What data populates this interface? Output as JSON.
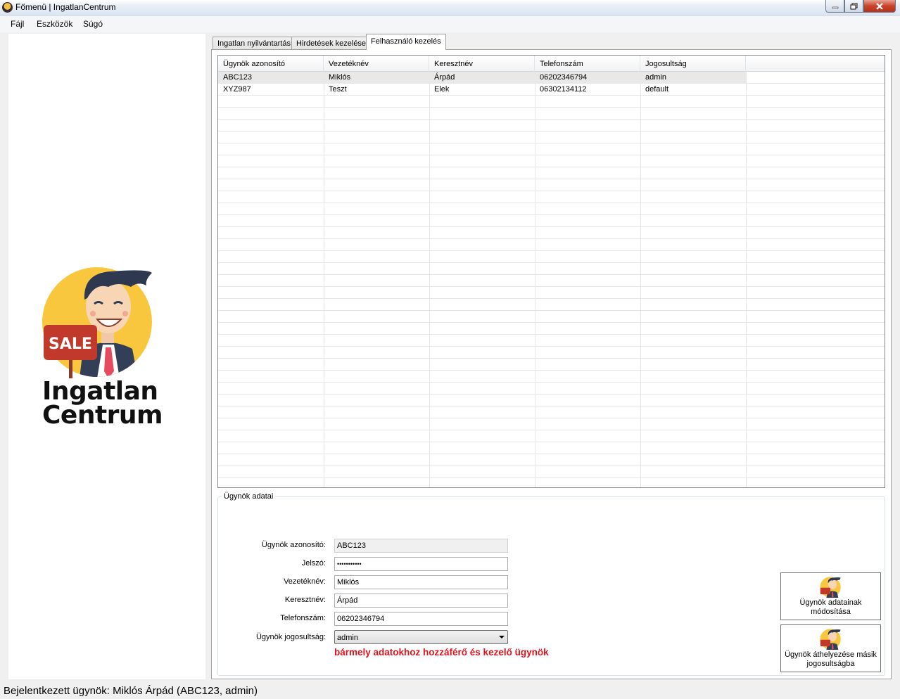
{
  "window": {
    "title": "Főmenü | IngatlanCentrum",
    "controls": [
      "minimize-icon",
      "maximize-icon",
      "close-icon"
    ]
  },
  "menu": {
    "items": [
      {
        "label": "Fájl"
      },
      {
        "label": "Eszközök"
      },
      {
        "label": "Súgó"
      }
    ]
  },
  "logo": {
    "sign_text": "SALE",
    "text_line1": "Ingatlan",
    "text_line2": "Centrum",
    "colors": {
      "circle": "#f9c73d",
      "suit": "#333e57",
      "tie": "#e64a5e",
      "sign": "#c0392b",
      "hair": "#2e3950"
    }
  },
  "tabs": [
    {
      "label": "Ingatlan nyilvántartás"
    },
    {
      "label": "Hirdetések kezelése"
    },
    {
      "label": "Felhasználó kezelés",
      "active": true
    }
  ],
  "grid": {
    "columns": [
      "Ügynök azonosító",
      "Vezetéknév",
      "Keresztnév",
      "Telefonszám",
      "Jogosultság"
    ],
    "rows": [
      [
        "ABC123",
        "Miklós",
        "Árpád",
        "06202346794",
        "admin"
      ],
      [
        "XYZ987",
        "Teszt",
        "Elek",
        "06302134112",
        "default"
      ]
    ],
    "selected_row": 0
  },
  "details": {
    "title": "Ügynök adatai",
    "fields": {
      "id_label": "Ügynök azonosító:",
      "id_value": "ABC123",
      "password_label": "Jelszó:",
      "password_value": "•••••••••••",
      "lastname_label": "Vezetéknév:",
      "lastname_value": "Miklós",
      "firstname_label": "Keresztnév:",
      "firstname_value": "Árpád",
      "phone_label": "Telefonszám:",
      "phone_value": "06202346794",
      "role_label": "Ügynök jogosultság:",
      "role_value": "admin"
    },
    "role_description": "bármely adatokhoz hozzáférő és kezelő ügynök",
    "role_description_color": "#e0141e",
    "buttons": {
      "modify": "Ügynök adatainak módosítása",
      "move": "Ügynök áthelyezése másik jogosultságba"
    }
  },
  "status": {
    "text": "Bejelentkezett ügynök: Miklós Árpád (ABC123, admin)"
  }
}
